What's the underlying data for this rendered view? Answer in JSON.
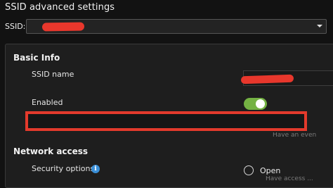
{
  "header": {
    "title": "SSID advanced settings"
  },
  "ssid_selector": {
    "label": "SSID:",
    "icon": "chevron-down-icon"
  },
  "basic_info": {
    "title": "Basic Info",
    "ssid_name_label": "SSID name",
    "enabled_label": "Enabled",
    "enabled": true,
    "toggle_color": "#74b243",
    "hint": "Have an even"
  },
  "network_access": {
    "title": "Network access",
    "security_label": "Security options",
    "info_icon": "info-icon",
    "option_open_label": "Open",
    "hint": "Have access ..."
  },
  "colors": {
    "accent_red": "#e33a2c",
    "background": "#121212",
    "panel": "#1e1e1e"
  }
}
